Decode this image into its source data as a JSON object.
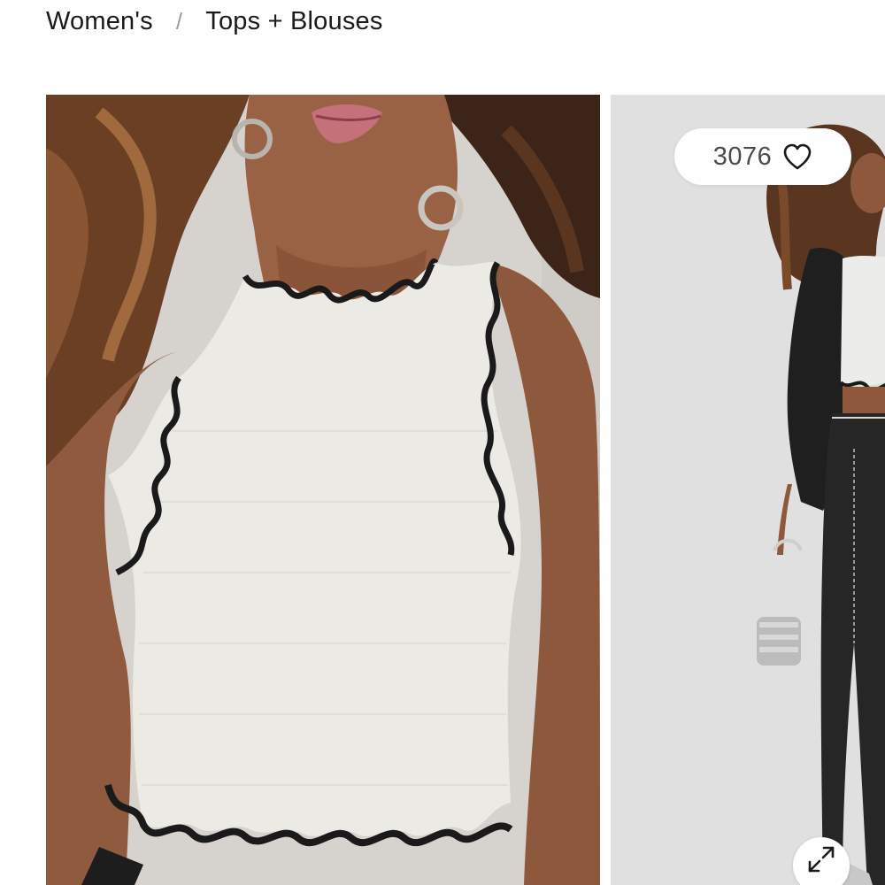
{
  "breadcrumb": {
    "items": [
      {
        "label": "Women's"
      },
      {
        "label": "Tops + Blouses"
      }
    ],
    "separator": "/"
  },
  "gallery": {
    "likes": {
      "count": "3076",
      "icon": "heart-icon"
    },
    "expand": {
      "icon": "expand-icon"
    },
    "images": [
      {
        "subject": "product-image-closeup"
      },
      {
        "subject": "product-image-full-look"
      }
    ]
  },
  "colors": {
    "text": "#1a1a1a",
    "separator": "#9a9a9a",
    "likes_text": "#4a4a4a",
    "pill_bg": "#ffffff"
  }
}
